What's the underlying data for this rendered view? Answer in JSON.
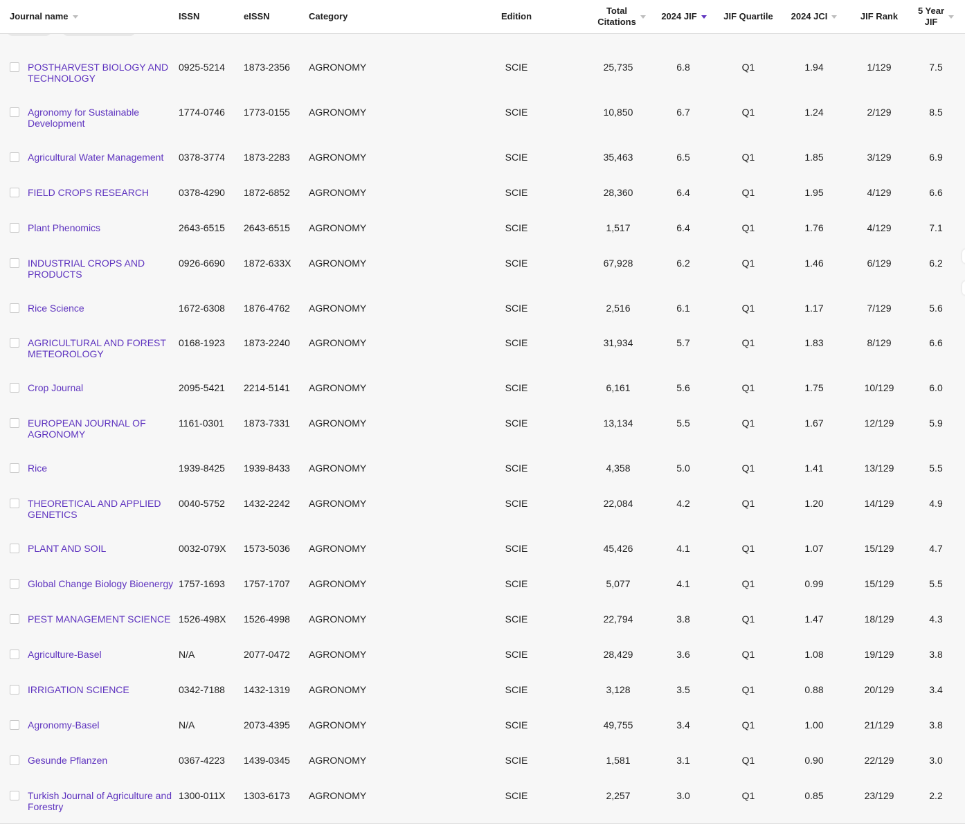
{
  "columns": {
    "journal_name": "Journal name",
    "issn": "ISSN",
    "eissn": "eISSN",
    "category": "Category",
    "edition": "Edition",
    "total_citations_line1": "Total",
    "total_citations_line2": "Citations",
    "jif": "2024 JIF",
    "jif_quartile": "JIF Quartile",
    "jci": "2024 JCI",
    "jif_rank": "JIF Rank",
    "five_year_line1": "5 Year",
    "five_year_line2": "JIF"
  },
  "sort_icons": {
    "inactive": "sort-down-icon",
    "active": "sort-down-active-icon",
    "active_color": "#5e33bf"
  },
  "colors": {
    "link": "#5e33bf",
    "row_bg": "#f7f7f7",
    "header_bg": "#ffffff",
    "divider": "#dedede"
  },
  "rows": [
    {
      "name": "POSTHARVEST BIOLOGY AND TECHNOLOGY",
      "issn": "0925-5214",
      "eissn": "1873-2356",
      "category": "AGRONOMY",
      "edition": "SCIE",
      "citations": "25,735",
      "jif": "6.8",
      "quartile": "Q1",
      "jci": "1.94",
      "rank": "1/129",
      "five_year": "7.5"
    },
    {
      "name": "Agronomy for Sustainable Development",
      "issn": "1774-0746",
      "eissn": "1773-0155",
      "category": "AGRONOMY",
      "edition": "SCIE",
      "citations": "10,850",
      "jif": "6.7",
      "quartile": "Q1",
      "jci": "1.24",
      "rank": "2/129",
      "five_year": "8.5"
    },
    {
      "name": "Agricultural Water Management",
      "issn": "0378-3774",
      "eissn": "1873-2283",
      "category": "AGRONOMY",
      "edition": "SCIE",
      "citations": "35,463",
      "jif": "6.5",
      "quartile": "Q1",
      "jci": "1.85",
      "rank": "3/129",
      "five_year": "6.9"
    },
    {
      "name": "FIELD CROPS RESEARCH",
      "issn": "0378-4290",
      "eissn": "1872-6852",
      "category": "AGRONOMY",
      "edition": "SCIE",
      "citations": "28,360",
      "jif": "6.4",
      "quartile": "Q1",
      "jci": "1.95",
      "rank": "4/129",
      "five_year": "6.6"
    },
    {
      "name": "Plant Phenomics",
      "issn": "2643-6515",
      "eissn": "2643-6515",
      "category": "AGRONOMY",
      "edition": "SCIE",
      "citations": "1,517",
      "jif": "6.4",
      "quartile": "Q1",
      "jci": "1.76",
      "rank": "4/129",
      "five_year": "7.1"
    },
    {
      "name": "INDUSTRIAL CROPS AND PRODUCTS",
      "issn": "0926-6690",
      "eissn": "1872-633X",
      "category": "AGRONOMY",
      "edition": "SCIE",
      "citations": "67,928",
      "jif": "6.2",
      "quartile": "Q1",
      "jci": "1.46",
      "rank": "6/129",
      "five_year": "6.2"
    },
    {
      "name": "Rice Science",
      "issn": "1672-6308",
      "eissn": "1876-4762",
      "category": "AGRONOMY",
      "edition": "SCIE",
      "citations": "2,516",
      "jif": "6.1",
      "quartile": "Q1",
      "jci": "1.17",
      "rank": "7/129",
      "five_year": "5.6"
    },
    {
      "name": "AGRICULTURAL AND FOREST METEOROLOGY",
      "issn": "0168-1923",
      "eissn": "1873-2240",
      "category": "AGRONOMY",
      "edition": "SCIE",
      "citations": "31,934",
      "jif": "5.7",
      "quartile": "Q1",
      "jci": "1.83",
      "rank": "8/129",
      "five_year": "6.6"
    },
    {
      "name": "Crop Journal",
      "issn": "2095-5421",
      "eissn": "2214-5141",
      "category": "AGRONOMY",
      "edition": "SCIE",
      "citations": "6,161",
      "jif": "5.6",
      "quartile": "Q1",
      "jci": "1.75",
      "rank": "10/129",
      "five_year": "6.0"
    },
    {
      "name": "EUROPEAN JOURNAL OF AGRONOMY",
      "issn": "1161-0301",
      "eissn": "1873-7331",
      "category": "AGRONOMY",
      "edition": "SCIE",
      "citations": "13,134",
      "jif": "5.5",
      "quartile": "Q1",
      "jci": "1.67",
      "rank": "12/129",
      "five_year": "5.9"
    },
    {
      "name": "Rice",
      "issn": "1939-8425",
      "eissn": "1939-8433",
      "category": "AGRONOMY",
      "edition": "SCIE",
      "citations": "4,358",
      "jif": "5.0",
      "quartile": "Q1",
      "jci": "1.41",
      "rank": "13/129",
      "five_year": "5.5"
    },
    {
      "name": "THEORETICAL AND APPLIED GENETICS",
      "issn": "0040-5752",
      "eissn": "1432-2242",
      "category": "AGRONOMY",
      "edition": "SCIE",
      "citations": "22,084",
      "jif": "4.2",
      "quartile": "Q1",
      "jci": "1.20",
      "rank": "14/129",
      "five_year": "4.9"
    },
    {
      "name": "PLANT AND SOIL",
      "issn": "0032-079X",
      "eissn": "1573-5036",
      "category": "AGRONOMY",
      "edition": "SCIE",
      "citations": "45,426",
      "jif": "4.1",
      "quartile": "Q1",
      "jci": "1.07",
      "rank": "15/129",
      "five_year": "4.7"
    },
    {
      "name": "Global Change Biology Bioenergy",
      "issn": "1757-1693",
      "eissn": "1757-1707",
      "category": "AGRONOMY",
      "edition": "SCIE",
      "citations": "5,077",
      "jif": "4.1",
      "quartile": "Q1",
      "jci": "0.99",
      "rank": "15/129",
      "five_year": "5.5"
    },
    {
      "name": "PEST MANAGEMENT SCIENCE",
      "issn": "1526-498X",
      "eissn": "1526-4998",
      "category": "AGRONOMY",
      "edition": "SCIE",
      "citations": "22,794",
      "jif": "3.8",
      "quartile": "Q1",
      "jci": "1.47",
      "rank": "18/129",
      "five_year": "4.3"
    },
    {
      "name": "Agriculture-Basel",
      "issn": "N/A",
      "eissn": "2077-0472",
      "category": "AGRONOMY",
      "edition": "SCIE",
      "citations": "28,429",
      "jif": "3.6",
      "quartile": "Q1",
      "jci": "1.08",
      "rank": "19/129",
      "five_year": "3.8"
    },
    {
      "name": "IRRIGATION SCIENCE",
      "issn": "0342-7188",
      "eissn": "1432-1319",
      "category": "AGRONOMY",
      "edition": "SCIE",
      "citations": "3,128",
      "jif": "3.5",
      "quartile": "Q1",
      "jci": "0.88",
      "rank": "20/129",
      "five_year": "3.4"
    },
    {
      "name": "Agronomy-Basel",
      "issn": "N/A",
      "eissn": "2073-4395",
      "category": "AGRONOMY",
      "edition": "SCIE",
      "citations": "49,755",
      "jif": "3.4",
      "quartile": "Q1",
      "jci": "1.00",
      "rank": "21/129",
      "five_year": "3.8"
    },
    {
      "name": "Gesunde Pflanzen",
      "issn": "0367-4223",
      "eissn": "1439-0345",
      "category": "AGRONOMY",
      "edition": "SCIE",
      "citations": "1,581",
      "jif": "3.1",
      "quartile": "Q1",
      "jci": "0.90",
      "rank": "22/129",
      "five_year": "3.0"
    },
    {
      "name": "Turkish Journal of Agriculture and Forestry",
      "issn": "1300-011X",
      "eissn": "1303-6173",
      "category": "AGRONOMY",
      "edition": "SCIE",
      "citations": "2,257",
      "jif": "3.0",
      "quartile": "Q1",
      "jci": "0.85",
      "rank": "23/129",
      "five_year": "2.2"
    }
  ]
}
